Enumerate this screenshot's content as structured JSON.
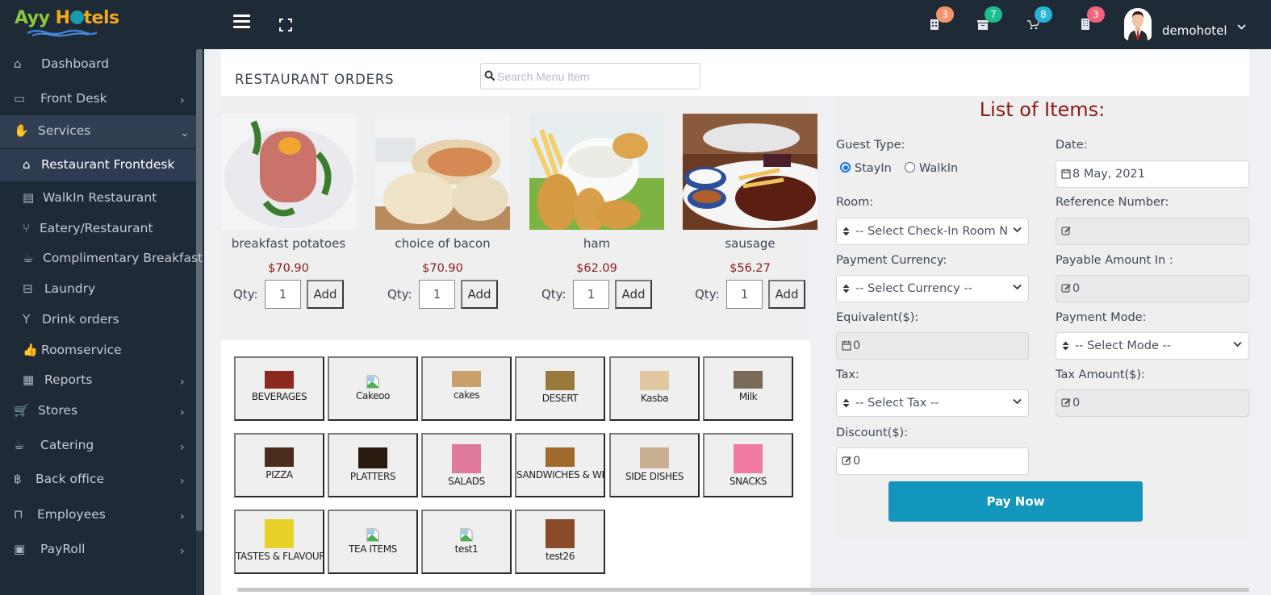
{
  "app": {
    "logo_part1": "Ayy",
    "logo_part2": "H",
    "logo_part3": "tels"
  },
  "topbar": {
    "menu_icon": "hamburger-icon",
    "fullscreen_icon": "expand-icon",
    "notifications": [
      {
        "icon": "hotel-building-icon",
        "count": "3",
        "color": "#f5956b"
      },
      {
        "icon": "archive-box-icon",
        "count": "7",
        "color": "#1cbf8e"
      },
      {
        "icon": "cart-icon",
        "count": "8",
        "color": "#26b5d6"
      },
      {
        "icon": "building-icon",
        "count": "3",
        "color": "#f1637a"
      }
    ],
    "user_name": "demohotel"
  },
  "sidebar": {
    "items": [
      {
        "label": "Dashboard",
        "icon": "home-icon"
      },
      {
        "label": "Front Desk",
        "icon": "desktop-icon",
        "has_children": true
      },
      {
        "label": "Services",
        "icon": "hand-icon",
        "has_children": true,
        "expanded": true
      },
      {
        "label": "Restaurant Frontdesk",
        "icon": "home-icon",
        "sub": true,
        "active": true
      },
      {
        "label": "WalkIn Restaurant",
        "icon": "credit-card-icon",
        "sub": true
      },
      {
        "label": "Eatery/Restaurant",
        "icon": "cutlery-icon",
        "sub": true
      },
      {
        "label": "Complimentary Breakfast",
        "icon": "coffee-icon",
        "sub": true
      },
      {
        "label": "Laundry",
        "icon": "basket-icon",
        "sub": true
      },
      {
        "label": "Drink orders",
        "icon": "cocktail-icon",
        "sub": true
      },
      {
        "label": "Roomservice",
        "icon": "thumbs-up-icon",
        "sub": true
      },
      {
        "label": "Reports",
        "icon": "newspaper-icon",
        "sub": true,
        "has_children": true
      },
      {
        "label": "Stores",
        "icon": "cart-icon",
        "has_children": true
      },
      {
        "label": "Catering",
        "icon": "coffee-icon",
        "has_children": true
      },
      {
        "label": "Back office",
        "icon": "bitcoin-icon",
        "has_children": true
      },
      {
        "label": "Employees",
        "icon": "inbox-icon",
        "has_children": true
      },
      {
        "label": "PayRoll",
        "icon": "money-icon",
        "has_children": true
      }
    ]
  },
  "main": {
    "title": "RESTAURANT ORDERS",
    "search_placeholder": "Search Menu Item",
    "qty_label": "Qty:",
    "add_label": "Add",
    "products": [
      {
        "name": "breakfast potatoes",
        "price": "$70.90",
        "qty": "1"
      },
      {
        "name": "choice of bacon",
        "price": "$70.90",
        "qty": "1"
      },
      {
        "name": "ham",
        "price": "$62.09",
        "qty": "1"
      },
      {
        "name": "sausage",
        "price": "$56.27",
        "qty": "1"
      }
    ],
    "categories": [
      {
        "label": "BEVERAGES",
        "img": "ok"
      },
      {
        "label": "Cakeoo",
        "img": "broken"
      },
      {
        "label": "cakes",
        "img": "ok"
      },
      {
        "label": "DESERT",
        "img": "ok"
      },
      {
        "label": "Kasba",
        "img": "ok"
      },
      {
        "label": "Milk",
        "img": "ok"
      },
      {
        "label": "PIZZA",
        "img": "ok"
      },
      {
        "label": "PLATTERS",
        "img": "ok"
      },
      {
        "label": "SALADS",
        "img": "ok"
      },
      {
        "label": "SANDWICHES & WRAPS",
        "img": "ok"
      },
      {
        "label": "SIDE DISHES",
        "img": "ok"
      },
      {
        "label": "SNACKS",
        "img": "ok"
      },
      {
        "label": "TASTES & FLAVOURS",
        "img": "ok"
      },
      {
        "label": "TEA ITEMS",
        "img": "broken"
      },
      {
        "label": "test1",
        "img": "broken"
      },
      {
        "label": "test26",
        "img": "ok"
      }
    ]
  },
  "order_panel": {
    "title": "List of Items:",
    "guest_type_label": "Guest Type:",
    "guest_types": [
      {
        "label": "StayIn",
        "checked": true
      },
      {
        "label": "WalkIn",
        "checked": false
      }
    ],
    "date_label": "Date:",
    "date_value": "8 May, 2021",
    "room_label": "Room:",
    "room_value": "-- Select Check-In Room N",
    "reference_label": "Reference Number:",
    "reference_value": "",
    "currency_label": "Payment Currency:",
    "currency_value": "-- Select Currency --",
    "payable_label": "Payable Amount In :",
    "payable_value": "0",
    "equivalent_label": "Equivalent($):",
    "equivalent_value": "0",
    "payment_mode_label": "Payment Mode:",
    "payment_mode_value": "-- Select Mode --",
    "tax_label": "Tax:",
    "tax_value": "-- Select Tax --",
    "tax_amount_label": "Tax Amount($):",
    "tax_amount_value": "0",
    "discount_label": "Discount($):",
    "discount_value": "0",
    "pay_now_label": "Pay Now"
  }
}
